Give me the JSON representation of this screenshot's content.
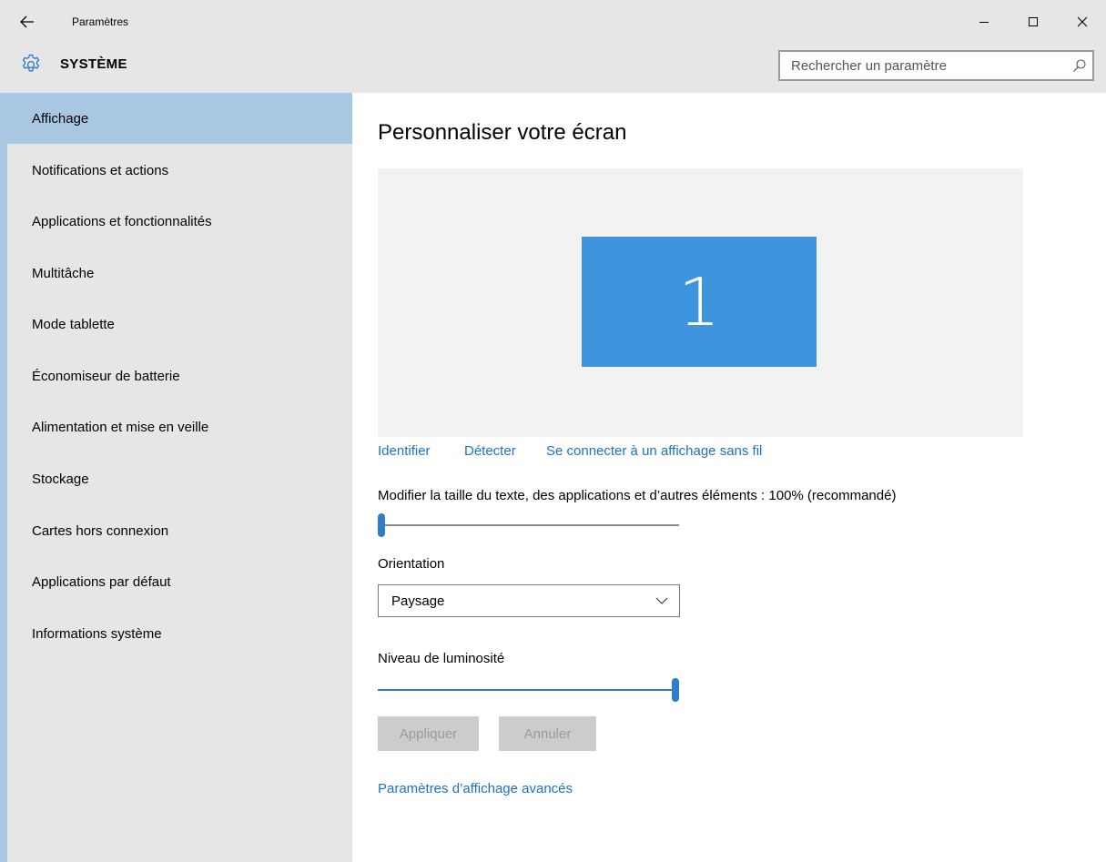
{
  "window": {
    "title": "Paramètres",
    "icons": {
      "back": "back-arrow-icon",
      "minimize": "minimize-icon",
      "maximize": "maximize-icon",
      "close": "close-icon"
    }
  },
  "header": {
    "title": "SYSTÈME",
    "icon": "gear-icon",
    "search_placeholder": "Rechercher un paramètre",
    "search_value": ""
  },
  "sidebar": {
    "items": [
      {
        "label": "Affichage",
        "active": true
      },
      {
        "label": "Notifications et actions"
      },
      {
        "label": "Applications et fonctionnalités"
      },
      {
        "label": "Multitâche"
      },
      {
        "label": "Mode tablette"
      },
      {
        "label": "Économiseur de batterie"
      },
      {
        "label": "Alimentation et mise en veille"
      },
      {
        "label": "Stockage"
      },
      {
        "label": "Cartes hors connexion"
      },
      {
        "label": "Applications par défaut"
      },
      {
        "label": "Informations système"
      }
    ]
  },
  "main": {
    "title": "Personnaliser votre écran",
    "monitor_number": "1",
    "links": {
      "identify": "Identifier",
      "detect": "Détecter",
      "wireless": "Se connecter à un affichage sans fil"
    },
    "text_size": {
      "label": "Modifier la taille du texte, des applications et d’autres éléments : 100% (recommandé)",
      "value_fraction": 0.0
    },
    "orientation": {
      "label": "Orientation",
      "selected": "Paysage"
    },
    "brightness": {
      "label": "Niveau de luminosité",
      "value_fraction": 1.0
    },
    "buttons": {
      "apply": "Appliquer",
      "cancel": "Annuler"
    },
    "advanced_link": "Paramètres d’affichage avancés"
  },
  "colors": {
    "accent": "#2d7dc7",
    "link": "#1e73c4",
    "sidebar_bg": "#e6e6e6",
    "selected_bg": "#a9c6e3",
    "monitor_tile": "#3f95dd"
  }
}
